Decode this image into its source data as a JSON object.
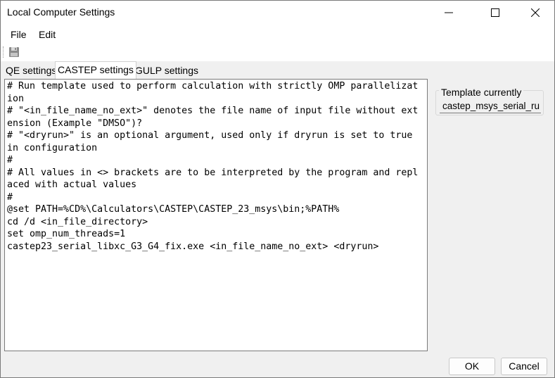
{
  "window": {
    "title": "Local Computer Settings"
  },
  "menu": {
    "file": "File",
    "edit": "Edit"
  },
  "toolbar": {
    "save_icon": "floppy-disk-icon"
  },
  "tabs": [
    {
      "label": "QE settings",
      "active": false
    },
    {
      "label": "CASTEP settings",
      "active": true
    },
    {
      "label": "GULP settings",
      "active": false
    }
  ],
  "editor": {
    "content": "# Run template used to perform calculation with strictly OMP parallelization\n# \"<in_file_name_no_ext>\" denotes the file name of input file without extension (Example \"DMSO\")?\n# \"<dryrun>\" is an optional argument, used only if dryrun is set to true in configuration\n#\n# All values in <> brackets are to be interpreted by the program and replaced with actual values\n#\n@set PATH=%CD%\\Calculators\\CASTEP\\CASTEP_23_msys\\bin;%PATH%\ncd /d <in_file_directory>\nset omp_num_threads=1\ncastep23_serial_libxc_G3_G4_fix.exe <in_file_name_no_ext> <dryrun>"
  },
  "template_group": {
    "label": "Template currently",
    "value": "castep_msys_serial_ru"
  },
  "buttons": {
    "ok": "OK",
    "cancel": "Cancel"
  }
}
